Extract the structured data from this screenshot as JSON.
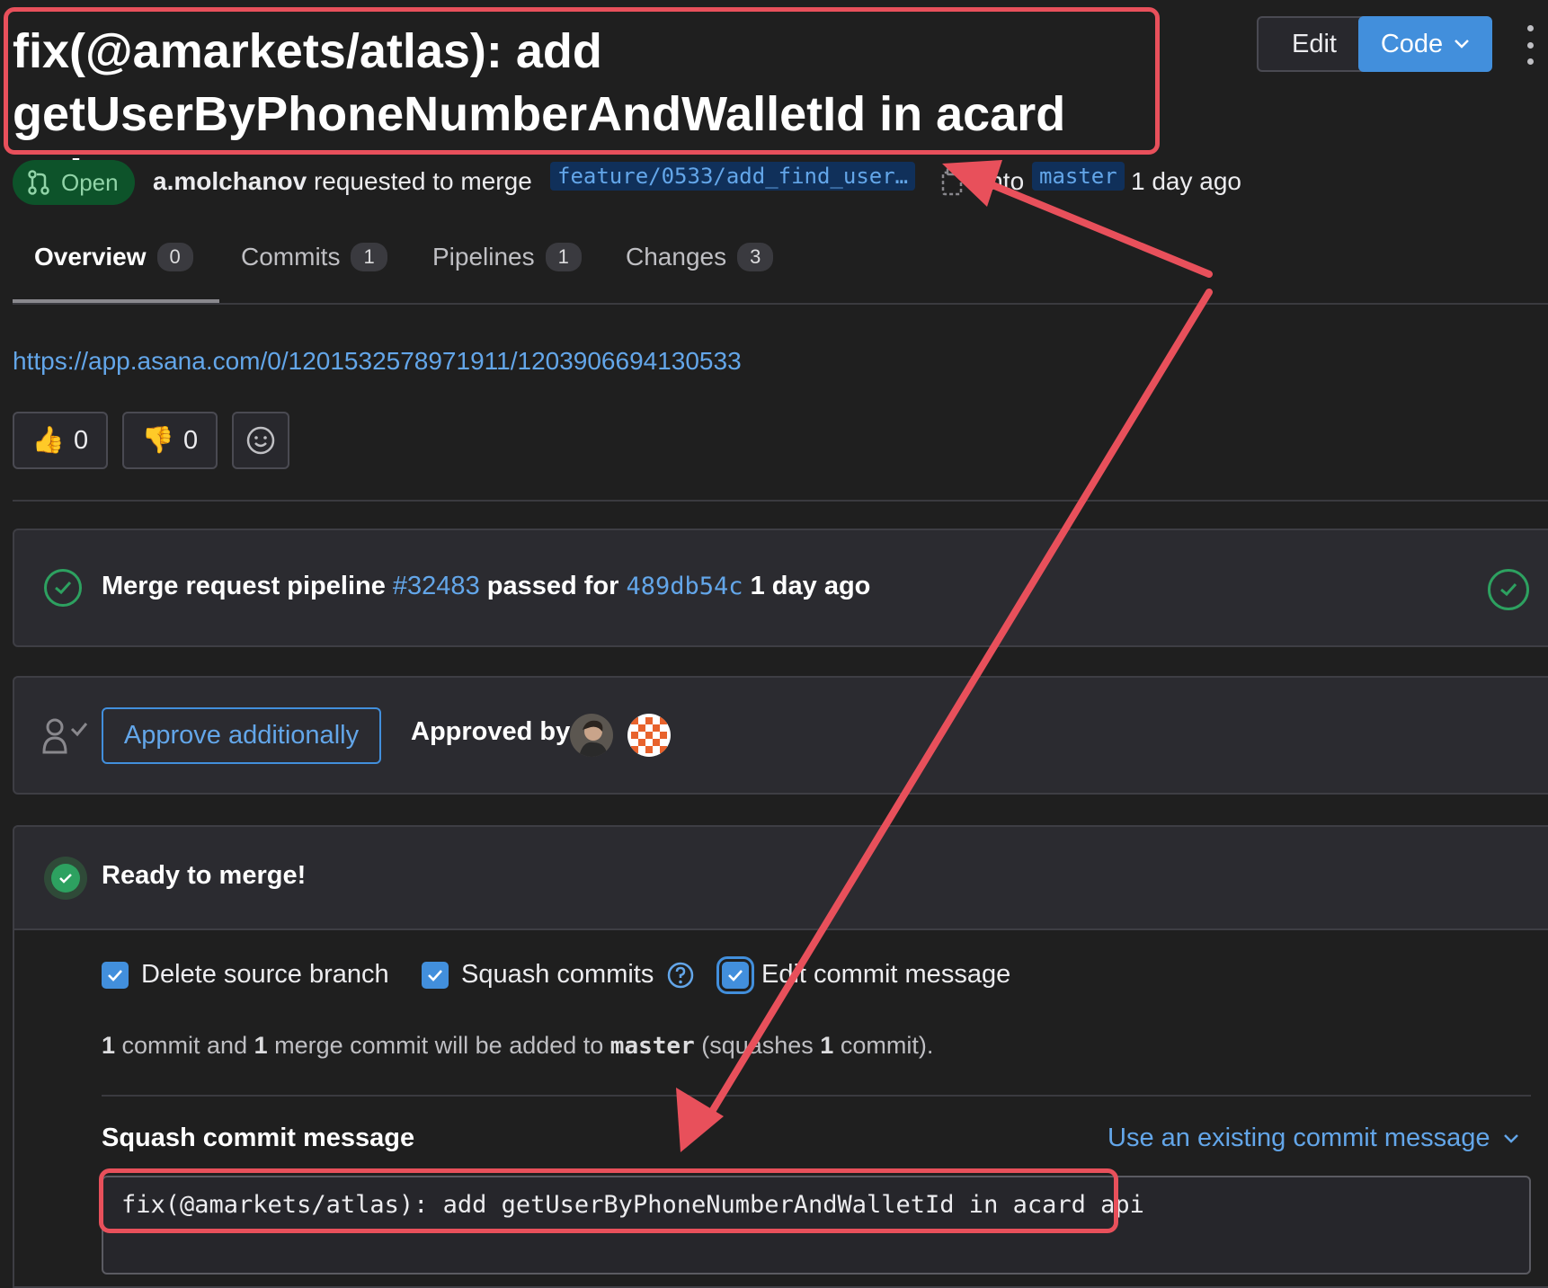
{
  "merge_request": {
    "title_line1": "fix(@amarkets/atlas): add",
    "title_line2": "getUserByPhoneNumberAndWalletId in acard api",
    "status": "Open",
    "author": "a.molchanov",
    "requested_text": "requested to merge",
    "source_branch": "feature/0533/add_find_user…",
    "into_text": "into",
    "target_branch": "master",
    "time_ago": "1 day ago"
  },
  "header_buttons": {
    "edit": "Edit",
    "code": "Code"
  },
  "tabs": [
    {
      "label": "Overview",
      "count": "0",
      "active": true
    },
    {
      "label": "Commits",
      "count": "1"
    },
    {
      "label": "Pipelines",
      "count": "1"
    },
    {
      "label": "Changes",
      "count": "3"
    }
  ],
  "description": {
    "link": "https://app.asana.com/0/1201532578971911/1203906694130533"
  },
  "reactions": {
    "thumbs_up_count": "0",
    "thumbs_down_count": "0"
  },
  "pipeline": {
    "prefix": "Merge request pipeline",
    "id": "#32483",
    "passed_for": "passed for",
    "commit": "489db54c",
    "time": "1 day ago"
  },
  "approval": {
    "button": "Approve additionally",
    "approved_by": "Approved by"
  },
  "ready": {
    "title": "Ready to merge!",
    "delete_source_branch": "Delete source branch",
    "squash_commits": "Squash commits",
    "edit_commit_message": "Edit commit message",
    "info_n1": "1",
    "info_t1": " commit and ",
    "info_n2": "1",
    "info_t2": " merge commit will be added to ",
    "info_branch": "master",
    "info_t3": " (squashes ",
    "info_n3": "1",
    "info_t4": " commit).",
    "squash_label": "Squash commit message",
    "use_existing": "Use an existing commit message",
    "commit_message": "fix(@amarkets/atlas): add getUserByPhoneNumberAndWalletId in acard api"
  },
  "colors": {
    "annotation": "#e8505b",
    "accent": "#428fdc",
    "success": "#2da160"
  }
}
